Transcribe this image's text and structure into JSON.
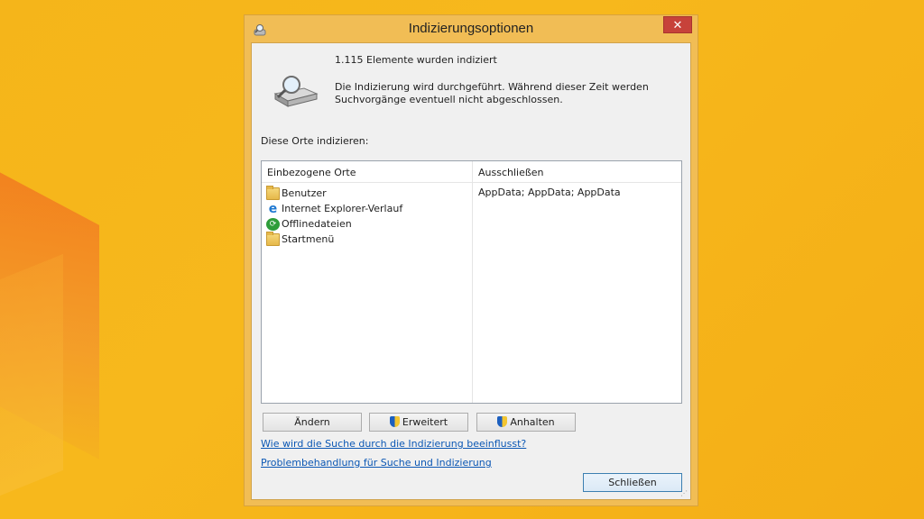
{
  "window": {
    "title": "Indizierungsoptionen",
    "close_glyph": "✕"
  },
  "status": {
    "count_text": "1.115 Elemente wurden indiziert",
    "message": "Die Indizierung wird durchgeführt. Während dieser Zeit werden Suchvorgänge eventuell nicht abgeschlossen."
  },
  "locations": {
    "label": "Diese Orte indizieren:",
    "columns": {
      "included": "Einbezogene Orte",
      "excluded": "Ausschließen"
    },
    "items": [
      {
        "label": "Benutzer",
        "icon": "folder-icon"
      },
      {
        "label": "Internet Explorer-Verlauf",
        "icon": "ie-icon"
      },
      {
        "label": "Offlinedateien",
        "icon": "sync-icon"
      },
      {
        "label": "Startmenü",
        "icon": "folder-icon"
      }
    ],
    "excluded_value": "AppData; AppData; AppData"
  },
  "buttons": {
    "change": "Ändern",
    "advanced": "Erweitert",
    "pause": "Anhalten",
    "close": "Schließen"
  },
  "links": {
    "how_search": "Wie wird die Suche durch die Indizierung beeinflusst?",
    "troubleshoot": "Problembehandlung für Suche und Indizierung"
  },
  "colors": {
    "desktop": "#f5b51a",
    "window_frame": "#f1bd55",
    "close_button": "#c7423a",
    "link": "#0b57b4"
  }
}
